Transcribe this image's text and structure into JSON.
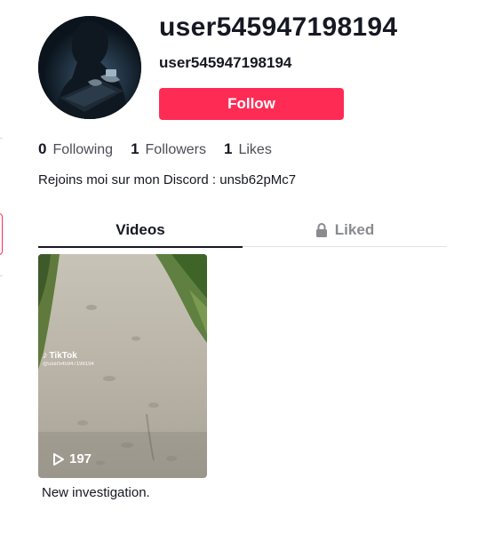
{
  "profile": {
    "title": "user545947198194",
    "subtitle": "user545947198194",
    "follow_label": "Follow",
    "bio": "Rejoins moi sur mon Discord : unsb62pMc7"
  },
  "stats": {
    "following": {
      "count": "0",
      "label": "Following"
    },
    "followers": {
      "count": "1",
      "label": "Followers"
    },
    "likes": {
      "count": "1",
      "label": "Likes"
    }
  },
  "tabs": [
    {
      "label": "Videos",
      "active": true
    },
    {
      "label": "Liked",
      "active": false,
      "icon": "lock-icon"
    }
  ],
  "videos": [
    {
      "views": "197",
      "caption": "New investigation.",
      "watermark": {
        "brand": "TikTok",
        "user": "@user545947198194"
      }
    }
  ],
  "colors": {
    "accent": "#fe2c55",
    "text": "#161823",
    "muted": "#8a8b91"
  }
}
